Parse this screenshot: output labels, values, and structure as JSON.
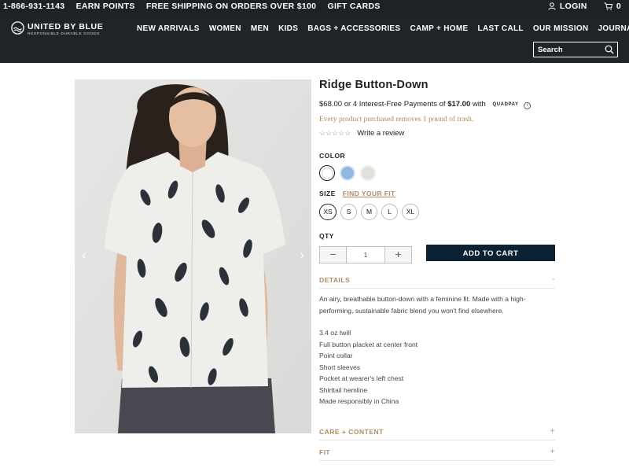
{
  "topbar": {
    "phone": "1-866-931-1143",
    "earn_points": "EARN POINTS",
    "shipping": "FREE SHIPPING ON ORDERS OVER $100",
    "gift_cards": "GIFT CARDS",
    "login": "LOGIN",
    "cart_count": "0"
  },
  "brand": {
    "name": "UNITED BY BLUE",
    "tagline": "RESPONSIBLE DURABLE GOODS"
  },
  "nav": {
    "items": [
      "NEW ARRIVALS",
      "WOMEN",
      "MEN",
      "KIDS",
      "BAGS + ACCESSORIES",
      "CAMP + HOME",
      "LAST CALL",
      "OUR MISSION",
      "JOURNAL"
    ]
  },
  "search": {
    "placeholder": "Search"
  },
  "product": {
    "title": "Ridge Button-Down",
    "price": "$68.00",
    "installment_prefix": "or 4 Interest-Free Payments of",
    "installment_amount": "$17.00",
    "installment_with": "with",
    "installment_provider": "QUADPAY",
    "trash_note": "Every product purchased removes 1 pound of trash.",
    "review_link": "Write a review",
    "stars": "☆☆☆☆☆"
  },
  "color": {
    "label": "COLOR",
    "swatches": [
      "#ffffff",
      "#8fb8e3",
      "#e3e1db"
    ],
    "selected_index": 0
  },
  "size": {
    "label": "SIZE",
    "fit_link": "FIND YOUR FIT",
    "options": [
      "XS",
      "S",
      "M",
      "L",
      "XL"
    ],
    "selected": "XS"
  },
  "quantity": {
    "label": "QTY",
    "value": "1",
    "minus": "−",
    "plus": "+"
  },
  "add_to_cart": "ADD TO CART",
  "details": {
    "heading": "DETAILS",
    "sign": "-",
    "description": "An airy, breathable button-down with a feminine fit. Made with a high-performing, sustainable fabric blend you won't find elsewhere.",
    "features": [
      "3.4 oz twill",
      "Full button placket at center front",
      "Point collar",
      "Short sleeves",
      "Pocket at wearer's left chest",
      "Shirttail hemline",
      "Made responsibly in China"
    ]
  },
  "care": {
    "heading": "CARE + CONTENT",
    "sign": "+"
  },
  "fit": {
    "heading": "FIT",
    "sign": "+"
  },
  "gallery": {
    "prev": "‹",
    "next": "›"
  }
}
